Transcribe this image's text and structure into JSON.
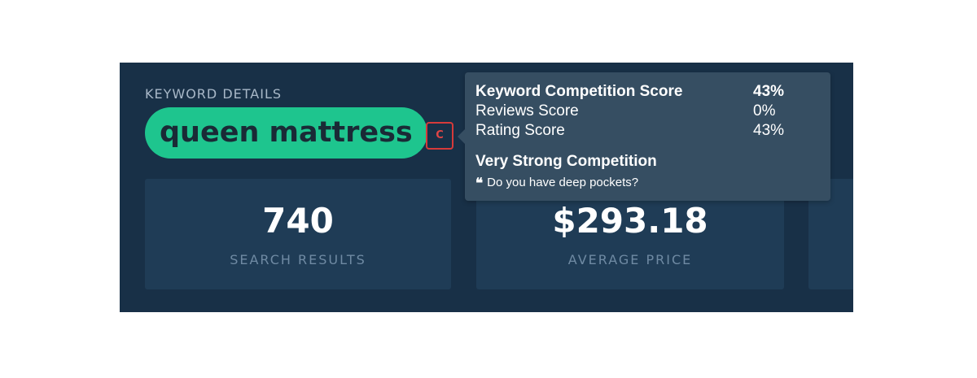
{
  "keyword_details": {
    "section_label": "KEYWORD DETAILS",
    "keyword": "queen mattress",
    "grade": "C"
  },
  "stats": [
    {
      "value": "740",
      "label": "SEARCH RESULTS"
    },
    {
      "value": "$293.18",
      "label": "AVERAGE PRICE"
    }
  ],
  "tooltip": {
    "rows": [
      {
        "name": "Keyword Competition Score",
        "value": "43%"
      },
      {
        "name": "Reviews Score",
        "value": "0%"
      },
      {
        "name": "Rating Score",
        "value": "43%"
      }
    ],
    "verdict": "Very Strong Competition",
    "quote_icon": "quote-icon",
    "quote": "Do you have deep pockets?"
  },
  "colors": {
    "panel_background": "#183047",
    "card_background": "#1f3c56",
    "keyword_pill": "#1ec58e",
    "grade_badge": "#d63a3a",
    "tooltip_background": "#364e62"
  }
}
